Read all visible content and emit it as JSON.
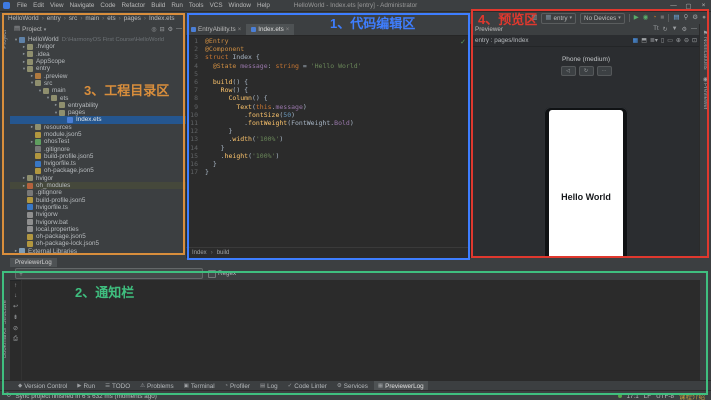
{
  "annotations": {
    "editor": {
      "label": "1、代码编辑区",
      "color": "#3E7EFF"
    },
    "notification": {
      "label": "2、通知栏",
      "color": "#3FBF7F"
    },
    "project": {
      "label": "3、工程目录区",
      "color": "#D98E3C"
    },
    "preview": {
      "label": "4、预览区",
      "color": "#E0382E"
    }
  },
  "titlebar": {
    "menus": [
      "File",
      "Edit",
      "View",
      "Navigate",
      "Code",
      "Refactor",
      "Build",
      "Run",
      "Tools",
      "VCS",
      "Window",
      "Help"
    ],
    "title": "HelloWorld - Index.ets [entry] - Administrator",
    "window_controls": [
      {
        "name": "minimize-button",
        "glyph": "—"
      },
      {
        "name": "maximize-button",
        "glyph": "▢"
      },
      {
        "name": "close-button",
        "glyph": "×"
      }
    ]
  },
  "breadcrumbs": [
    "HelloWorld",
    "entry",
    "src",
    "main",
    "ets",
    "pages",
    "Index.ets"
  ],
  "toolbar": {
    "items": [
      {
        "type": "icon",
        "name": "device-manager-icon",
        "glyph": "▥",
        "color": "#9da0a3"
      },
      {
        "type": "select",
        "name": "module-selector",
        "glyph": "▦",
        "label": "entry"
      },
      {
        "type": "select",
        "name": "device-selector",
        "glyph": "",
        "label": "No Devices"
      },
      {
        "type": "sep"
      },
      {
        "type": "icon",
        "name": "run-button",
        "glyph": "▶",
        "color": "#59a869"
      },
      {
        "type": "icon",
        "name": "debug-button",
        "glyph": "◉",
        "color": "#59a869"
      },
      {
        "type": "icon",
        "name": "profiler-button",
        "glyph": "◔",
        "color": "#c57f33"
      },
      {
        "type": "icon",
        "name": "stop-button",
        "glyph": "■",
        "color": "#6e6e6e"
      },
      {
        "type": "sep"
      },
      {
        "type": "icon",
        "name": "device-file-browser-icon",
        "glyph": "▤",
        "color": "#6fa8dc"
      },
      {
        "type": "icon",
        "name": "search-everywhere-icon",
        "glyph": "⚲",
        "color": "#9da0a3"
      },
      {
        "type": "icon",
        "name": "settings-icon",
        "glyph": "⚙",
        "color": "#9da0a3"
      },
      {
        "type": "icon",
        "name": "avatar",
        "glyph": "●",
        "color": "#8a8a8a"
      }
    ]
  },
  "left_stripe": {
    "top": "Project",
    "bottom": [
      "Structure",
      "Bookmarks"
    ]
  },
  "project_panel": {
    "title": "Project",
    "header_icons": [
      {
        "name": "locate-file-icon",
        "glyph": "◎"
      },
      {
        "name": "collapse-all-icon",
        "glyph": "⊟"
      },
      {
        "name": "settings-icon",
        "glyph": "⚙"
      },
      {
        "name": "hide-panel-icon",
        "glyph": "—"
      }
    ],
    "tree": [
      {
        "ind": 0,
        "arrow": "v",
        "icon": "project",
        "text": "HelloWorld",
        "extra": "D:\\HarmonyOS First Course\\HelloWorld"
      },
      {
        "ind": 1,
        "arrow": ">",
        "icon": "folder",
        "text": ".hvigor"
      },
      {
        "ind": 1,
        "arrow": ">",
        "icon": "folder",
        "text": ".idea"
      },
      {
        "ind": 1,
        "arrow": ">",
        "icon": "folder",
        "text": "AppScope"
      },
      {
        "ind": 1,
        "arrow": "v",
        "icon": "module",
        "text": "entry"
      },
      {
        "ind": 2,
        "arrow": ">",
        "icon": "preview-folder",
        "text": ".preview"
      },
      {
        "ind": 2,
        "arrow": "v",
        "icon": "folder",
        "text": "src"
      },
      {
        "ind": 3,
        "arrow": "v",
        "icon": "folder",
        "text": "main"
      },
      {
        "ind": 4,
        "arrow": "v",
        "icon": "folder",
        "text": "ets"
      },
      {
        "ind": 5,
        "arrow": ">",
        "icon": "folder",
        "text": "entryability"
      },
      {
        "ind": 5,
        "arrow": "v",
        "icon": "folder",
        "text": "pages"
      },
      {
        "ind": 6,
        "arrow": "",
        "icon": "ets",
        "text": "Index.ets",
        "state": "selected"
      },
      {
        "ind": 2,
        "arrow": ">",
        "icon": "resources-folder",
        "text": "resources"
      },
      {
        "ind": 2,
        "arrow": "",
        "icon": "json",
        "text": "module.json5"
      },
      {
        "ind": 2,
        "arrow": ">",
        "icon": "test-folder",
        "text": "ohosTest"
      },
      {
        "ind": 2,
        "arrow": "",
        "icon": "git",
        "text": ".gitignore"
      },
      {
        "ind": 2,
        "arrow": "",
        "icon": "json",
        "text": "build-profile.json5"
      },
      {
        "ind": 2,
        "arrow": "",
        "icon": "ts",
        "text": "hvigorfile.ts"
      },
      {
        "ind": 2,
        "arrow": "",
        "icon": "json",
        "text": "oh-package.json5"
      },
      {
        "ind": 1,
        "arrow": ">",
        "icon": "folder",
        "text": "hvigor"
      },
      {
        "ind": 1,
        "arrow": ">",
        "icon": "modules-folder",
        "text": "oh_modules",
        "state": "hover"
      },
      {
        "ind": 1,
        "arrow": "",
        "icon": "git",
        "text": ".gitignore"
      },
      {
        "ind": 1,
        "arrow": "",
        "icon": "json",
        "text": "build-profile.json5"
      },
      {
        "ind": 1,
        "arrow": "",
        "icon": "ts",
        "text": "hvigorfile.ts"
      },
      {
        "ind": 1,
        "arrow": "",
        "icon": "file",
        "text": "hvigorw"
      },
      {
        "ind": 1,
        "arrow": "",
        "icon": "file",
        "text": "hvigorw.bat"
      },
      {
        "ind": 1,
        "arrow": "",
        "icon": "props",
        "text": "local.properties"
      },
      {
        "ind": 1,
        "arrow": "",
        "icon": "json",
        "text": "oh-package.json5"
      },
      {
        "ind": 1,
        "arrow": "",
        "icon": "json",
        "text": "oh-package-lock.json5"
      },
      {
        "ind": 0,
        "arrow": ">",
        "icon": "lib",
        "text": "External Libraries"
      }
    ]
  },
  "editor": {
    "tabs": [
      {
        "label": "EntryAbility.ts",
        "active": false
      },
      {
        "label": "Index.ets",
        "active": true
      }
    ],
    "inspection_ok": "✓",
    "breadcrumb": [
      "Index",
      "build"
    ],
    "lines": [
      {
        "n": 1,
        "toks": [
          [
            "@Entry",
            "d"
          ]
        ]
      },
      {
        "n": 2,
        "toks": [
          [
            "@Component",
            "d"
          ]
        ]
      },
      {
        "n": 3,
        "toks": [
          [
            "struct",
            "k"
          ],
          [
            " Index {",
            "v"
          ]
        ]
      },
      {
        "n": 4,
        "toks": [
          [
            "  ",
            "v"
          ],
          [
            "@State",
            "d"
          ],
          [
            " ",
            "v"
          ],
          [
            "message",
            "p"
          ],
          [
            ": ",
            "v"
          ],
          [
            "string",
            "k"
          ],
          [
            " = ",
            "v"
          ],
          [
            "'Hello World'",
            "s"
          ]
        ]
      },
      {
        "n": 5,
        "toks": []
      },
      {
        "n": 6,
        "toks": [
          [
            "  ",
            "v"
          ],
          [
            "build",
            "f"
          ],
          [
            "() {",
            "v"
          ]
        ]
      },
      {
        "n": 7,
        "toks": [
          [
            "    ",
            "v"
          ],
          [
            "Row",
            "f"
          ],
          [
            "() {",
            "v"
          ]
        ]
      },
      {
        "n": 8,
        "toks": [
          [
            "      ",
            "v"
          ],
          [
            "Column",
            "f"
          ],
          [
            "() {",
            "v"
          ]
        ]
      },
      {
        "n": 9,
        "toks": [
          [
            "        ",
            "v"
          ],
          [
            "Text",
            "f"
          ],
          [
            "(",
            "v"
          ],
          [
            "this",
            "k"
          ],
          [
            ".",
            "v"
          ],
          [
            "message",
            "p"
          ],
          [
            ")",
            "v"
          ]
        ]
      },
      {
        "n": 10,
        "toks": [
          [
            "          .",
            "v"
          ],
          [
            "fontSize",
            "f"
          ],
          [
            "(",
            "v"
          ],
          [
            "50",
            "n"
          ],
          [
            ")",
            "v"
          ]
        ]
      },
      {
        "n": 11,
        "toks": [
          [
            "          .",
            "v"
          ],
          [
            "fontWeight",
            "f"
          ],
          [
            "(FontWeight.",
            "v"
          ],
          [
            "Bold",
            "p"
          ],
          [
            ")",
            "v"
          ]
        ]
      },
      {
        "n": 12,
        "toks": [
          [
            "      }",
            "v"
          ]
        ]
      },
      {
        "n": 13,
        "toks": [
          [
            "      .",
            "v"
          ],
          [
            "width",
            "f"
          ],
          [
            "(",
            "v"
          ],
          [
            "'100%'",
            "s"
          ],
          [
            ")",
            "v"
          ]
        ]
      },
      {
        "n": 14,
        "toks": [
          [
            "    }",
            "v"
          ]
        ]
      },
      {
        "n": 15,
        "toks": [
          [
            "    .",
            "v"
          ],
          [
            "height",
            "f"
          ],
          [
            "(",
            "v"
          ],
          [
            "'100%'",
            "s"
          ],
          [
            ")",
            "v"
          ]
        ]
      },
      {
        "n": 16,
        "toks": [
          [
            "  }",
            "v"
          ]
        ]
      },
      {
        "n": 17,
        "toks": [
          [
            "}",
            "v"
          ]
        ]
      }
    ]
  },
  "previewer": {
    "title": "Previewer",
    "header_icons": [
      {
        "name": "font-size-icon",
        "glyph": "Tt"
      },
      {
        "name": "refresh-icon",
        "glyph": "↻"
      },
      {
        "name": "filter-icon",
        "glyph": "▼"
      },
      {
        "name": "settings-icon",
        "glyph": "⚙"
      },
      {
        "name": "hide-panel-icon",
        "glyph": "—"
      }
    ],
    "target": "entry : pages/Index",
    "control_icons": [
      {
        "name": "grid-view-icon",
        "glyph": "▦",
        "active": true
      },
      {
        "name": "component-tree-icon",
        "glyph": "⬒"
      },
      {
        "name": "layout-dropdown-icon",
        "glyph": "≣▾"
      },
      {
        "name": "portrait-icon",
        "glyph": "▯"
      },
      {
        "name": "landscape-icon",
        "glyph": "▭"
      },
      {
        "name": "zoom-in-icon",
        "glyph": "⊕"
      },
      {
        "name": "zoom-out-icon",
        "glyph": "⊖"
      },
      {
        "name": "fit-screen-icon",
        "glyph": "⊡"
      }
    ],
    "device_label": "Phone (medium)",
    "buttons": [
      {
        "name": "back-button",
        "glyph": "◁"
      },
      {
        "name": "rotate-button",
        "glyph": "↻"
      },
      {
        "name": "more-button",
        "glyph": "⋯"
      }
    ],
    "phone_text": "Hello World"
  },
  "right_stripe": [
    {
      "label": "Notifications",
      "glyph": "⚑"
    },
    {
      "label": "Previewer",
      "glyph": "◉"
    }
  ],
  "bottom_panel": {
    "tab": "PreviewerLog",
    "regex_label": "Regex",
    "tool_icons": [
      {
        "name": "scroll-up-icon",
        "glyph": "↑"
      },
      {
        "name": "scroll-down-icon",
        "glyph": "↓"
      },
      {
        "name": "soft-wrap-icon",
        "glyph": "↩"
      },
      {
        "name": "scroll-to-end-icon",
        "glyph": "⇟"
      },
      {
        "name": "clear-log-icon",
        "glyph": "⊘"
      },
      {
        "name": "print-icon",
        "glyph": "⎙"
      }
    ]
  },
  "toolwindow_bar": [
    {
      "label": "Version Control",
      "glyph": "◆"
    },
    {
      "label": "Run",
      "glyph": "▶"
    },
    {
      "label": "TODO",
      "glyph": "☰"
    },
    {
      "label": "Problems",
      "glyph": "⚠"
    },
    {
      "label": "Terminal",
      "glyph": "▣"
    },
    {
      "label": "Profiler",
      "glyph": "◔"
    },
    {
      "label": "Log",
      "glyph": "▤"
    },
    {
      "label": "Code Linter",
      "glyph": "✓"
    },
    {
      "label": "Services",
      "glyph": "⚙"
    },
    {
      "label": "PreviewerLog",
      "glyph": "▦",
      "active": true
    }
  ],
  "statusbar": {
    "message": "Sync project finished in 6 s 632 ms (moments ago)",
    "position": "17:1",
    "line_ending": "LF",
    "encoding": "UTF-8",
    "watermark": "课程介绍"
  },
  "icon_colors": {
    "project": "#5f82a8",
    "folder": "#8f8f6e",
    "module": "#8f8f6e",
    "preview-folder": "#b07a3f",
    "resources-folder": "#8f8f6e",
    "test-folder": "#5f9e5f",
    "modules-folder": "#b5623d",
    "ets": "#4b7fd6",
    "json": "#b2973f",
    "ts": "#3977c4",
    "git": "#787878",
    "file": "#8f8f8f",
    "props": "#8f8f8f",
    "lib": "#7f9cb5"
  }
}
